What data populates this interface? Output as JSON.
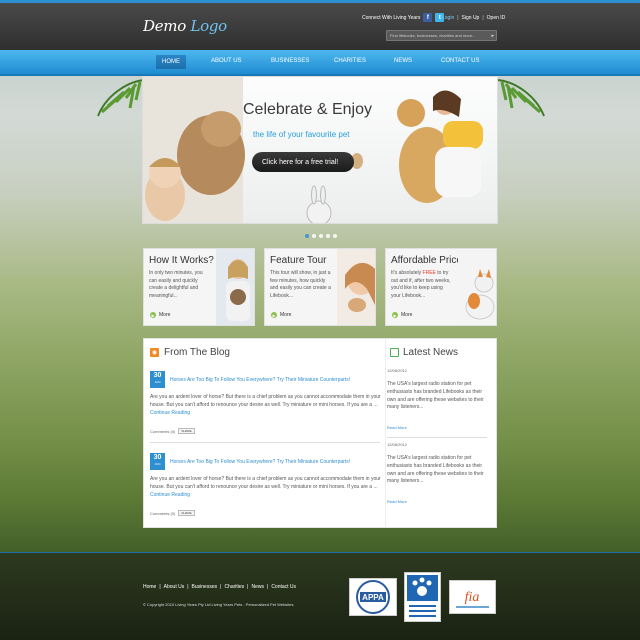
{
  "header": {
    "logo_main": "Demo",
    "logo_accent": "Logo",
    "connect_label": "Connect With Living Years",
    "links": [
      "Login",
      "Sign Up",
      "Open ID"
    ],
    "search_placeholder": "Find lifebooks, businesses, charities and more..."
  },
  "nav": [
    "HOME",
    "ABOUT US",
    "BUSINESSES",
    "CHARITIES",
    "NEWS",
    "CONTACT US"
  ],
  "hero": {
    "title": "Celebrate & Enjoy",
    "subtitle": "the life of your favourite pet",
    "cta": "Click here for a free trial!",
    "slides": 5,
    "active_slide": 1
  },
  "features": [
    {
      "title": "How It Works?",
      "text": "In only two minutes, you can easily and quickly create a delightful and meaningful...",
      "more": "More"
    },
    {
      "title": "Feature Tour",
      "text": "This tour will show, in just a few minutes, how quickly and easily you can create a Lifebook...",
      "more": "More"
    },
    {
      "title": "Affordable Prices",
      "text_a": "It's absolutely ",
      "text_free": "FREE",
      "text_b": " to try out and if, after two weeks, you'd like to keep using your Lifebook...",
      "more": "More"
    }
  ],
  "blog": {
    "title": "From The Blog",
    "posts": [
      {
        "day": "30",
        "month": "JUN",
        "title": "Horses Are Too Big To Follow You Everywhere? Try Their Miniature Counterparts!",
        "body": "Are you an ardent lover of horse? But there is a chief problem as you cannot accommodate them in your house. But you can't afford to renounce your desire as well. Try miniature or mini horses. If you are a ...",
        "continue": "Continue Reading",
        "comments": "Comments (0)",
        "share": "SHARE"
      },
      {
        "day": "30",
        "month": "JUN",
        "title": "Horses Are Too Big To Follow You Everywhere? Try Their Miniature Counterparts!",
        "body": "Are you an ardent lover of horse? But there is a chief problem as you cannot accommodate them in your house. But you can't afford to renounce your desire as well. Try miniature or mini horses. If you are a ...",
        "continue": "Continue Reading",
        "comments": "Comments (0)",
        "share": "SHARE"
      }
    ]
  },
  "news": {
    "title": "Latest News",
    "items": [
      {
        "date": "12/06/2012",
        "body": "The USA's largest radio station for pet enthusiasts has branded Lifebooks as their own and are offering these websites to their many listeners...",
        "read_more": "Read More"
      },
      {
        "date": "12/06/2012",
        "body": "The USA's largest radio station for pet enthusiasts has branded Lifebooks as their own and are offering these websites to their many listeners...",
        "read_more": "Read More"
      }
    ]
  },
  "footer": {
    "links": [
      "Home",
      "About Us",
      "Businesses",
      "Charities",
      "News",
      "Contact Us"
    ],
    "copyright": "© Copyright 2010 Living Years Pty Ltd Living Years Pets - Personalized Pet Websites",
    "badges": [
      "APPA",
      "fia"
    ]
  },
  "colors": {
    "accent": "#2e8fd0",
    "nav": "#2b9be0",
    "header": "#3a3a3a",
    "free": "#e63b2e",
    "more": "#8ac04a"
  }
}
